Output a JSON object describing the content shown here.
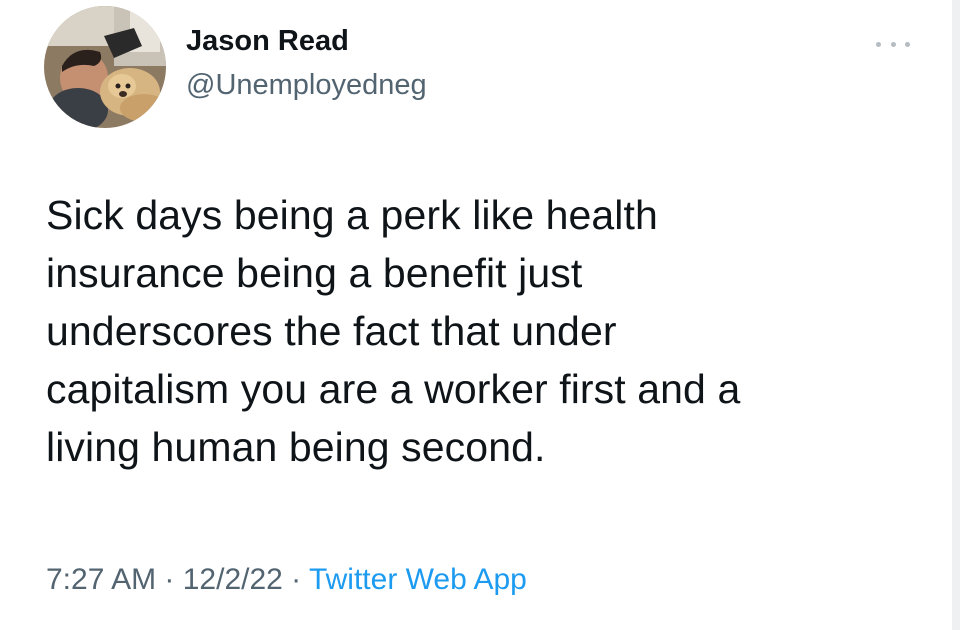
{
  "tweet": {
    "author": {
      "display_name": "Jason Read",
      "handle": "@Unemployedneg"
    },
    "text_lines": [
      "Sick days being a perk like health",
      "insurance being a benefit just",
      "underscores the fact that under",
      "capitalism you are a worker first and a",
      "living human being second."
    ],
    "meta": {
      "time": "7:27 AM",
      "separator": " · ",
      "date": "12/2/22",
      "source": "Twitter Web App"
    },
    "icons": {
      "more": "more-horizontal-icon"
    },
    "colors": {
      "text_primary": "#0f1419",
      "text_secondary": "#536471",
      "link": "#1d9bf0"
    }
  }
}
